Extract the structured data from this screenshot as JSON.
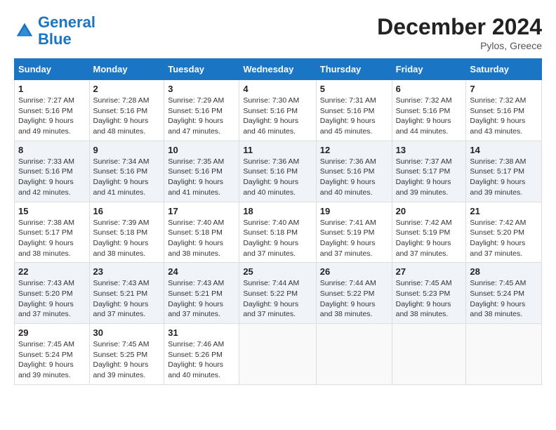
{
  "header": {
    "logo_line1": "General",
    "logo_line2": "Blue",
    "month_title": "December 2024",
    "location": "Pylos, Greece"
  },
  "days_of_week": [
    "Sunday",
    "Monday",
    "Tuesday",
    "Wednesday",
    "Thursday",
    "Friday",
    "Saturday"
  ],
  "weeks": [
    [
      {
        "day": 1,
        "sunrise": "7:27 AM",
        "sunset": "5:16 PM",
        "daylight": "9 hours and 49 minutes."
      },
      {
        "day": 2,
        "sunrise": "7:28 AM",
        "sunset": "5:16 PM",
        "daylight": "9 hours and 48 minutes."
      },
      {
        "day": 3,
        "sunrise": "7:29 AM",
        "sunset": "5:16 PM",
        "daylight": "9 hours and 47 minutes."
      },
      {
        "day": 4,
        "sunrise": "7:30 AM",
        "sunset": "5:16 PM",
        "daylight": "9 hours and 46 minutes."
      },
      {
        "day": 5,
        "sunrise": "7:31 AM",
        "sunset": "5:16 PM",
        "daylight": "9 hours and 45 minutes."
      },
      {
        "day": 6,
        "sunrise": "7:32 AM",
        "sunset": "5:16 PM",
        "daylight": "9 hours and 44 minutes."
      },
      {
        "day": 7,
        "sunrise": "7:32 AM",
        "sunset": "5:16 PM",
        "daylight": "9 hours and 43 minutes."
      }
    ],
    [
      {
        "day": 8,
        "sunrise": "7:33 AM",
        "sunset": "5:16 PM",
        "daylight": "9 hours and 42 minutes."
      },
      {
        "day": 9,
        "sunrise": "7:34 AM",
        "sunset": "5:16 PM",
        "daylight": "9 hours and 41 minutes."
      },
      {
        "day": 10,
        "sunrise": "7:35 AM",
        "sunset": "5:16 PM",
        "daylight": "9 hours and 41 minutes."
      },
      {
        "day": 11,
        "sunrise": "7:36 AM",
        "sunset": "5:16 PM",
        "daylight": "9 hours and 40 minutes."
      },
      {
        "day": 12,
        "sunrise": "7:36 AM",
        "sunset": "5:16 PM",
        "daylight": "9 hours and 40 minutes."
      },
      {
        "day": 13,
        "sunrise": "7:37 AM",
        "sunset": "5:17 PM",
        "daylight": "9 hours and 39 minutes."
      },
      {
        "day": 14,
        "sunrise": "7:38 AM",
        "sunset": "5:17 PM",
        "daylight": "9 hours and 39 minutes."
      }
    ],
    [
      {
        "day": 15,
        "sunrise": "7:38 AM",
        "sunset": "5:17 PM",
        "daylight": "9 hours and 38 minutes."
      },
      {
        "day": 16,
        "sunrise": "7:39 AM",
        "sunset": "5:18 PM",
        "daylight": "9 hours and 38 minutes."
      },
      {
        "day": 17,
        "sunrise": "7:40 AM",
        "sunset": "5:18 PM",
        "daylight": "9 hours and 38 minutes."
      },
      {
        "day": 18,
        "sunrise": "7:40 AM",
        "sunset": "5:18 PM",
        "daylight": "9 hours and 37 minutes."
      },
      {
        "day": 19,
        "sunrise": "7:41 AM",
        "sunset": "5:19 PM",
        "daylight": "9 hours and 37 minutes."
      },
      {
        "day": 20,
        "sunrise": "7:42 AM",
        "sunset": "5:19 PM",
        "daylight": "9 hours and 37 minutes."
      },
      {
        "day": 21,
        "sunrise": "7:42 AM",
        "sunset": "5:20 PM",
        "daylight": "9 hours and 37 minutes."
      }
    ],
    [
      {
        "day": 22,
        "sunrise": "7:43 AM",
        "sunset": "5:20 PM",
        "daylight": "9 hours and 37 minutes."
      },
      {
        "day": 23,
        "sunrise": "7:43 AM",
        "sunset": "5:21 PM",
        "daylight": "9 hours and 37 minutes."
      },
      {
        "day": 24,
        "sunrise": "7:43 AM",
        "sunset": "5:21 PM",
        "daylight": "9 hours and 37 minutes."
      },
      {
        "day": 25,
        "sunrise": "7:44 AM",
        "sunset": "5:22 PM",
        "daylight": "9 hours and 37 minutes."
      },
      {
        "day": 26,
        "sunrise": "7:44 AM",
        "sunset": "5:22 PM",
        "daylight": "9 hours and 38 minutes."
      },
      {
        "day": 27,
        "sunrise": "7:45 AM",
        "sunset": "5:23 PM",
        "daylight": "9 hours and 38 minutes."
      },
      {
        "day": 28,
        "sunrise": "7:45 AM",
        "sunset": "5:24 PM",
        "daylight": "9 hours and 38 minutes."
      }
    ],
    [
      {
        "day": 29,
        "sunrise": "7:45 AM",
        "sunset": "5:24 PM",
        "daylight": "9 hours and 39 minutes."
      },
      {
        "day": 30,
        "sunrise": "7:45 AM",
        "sunset": "5:25 PM",
        "daylight": "9 hours and 39 minutes."
      },
      {
        "day": 31,
        "sunrise": "7:46 AM",
        "sunset": "5:26 PM",
        "daylight": "9 hours and 40 minutes."
      },
      null,
      null,
      null,
      null
    ]
  ]
}
